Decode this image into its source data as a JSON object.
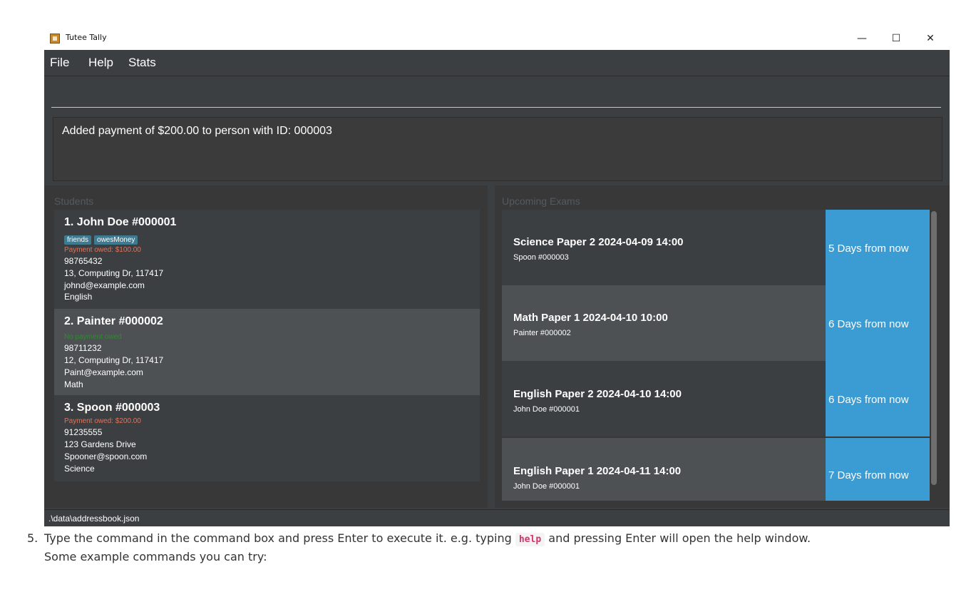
{
  "window": {
    "title": "Tutee Tally",
    "controls": {
      "minimize": "—",
      "maximize": "☐",
      "close": "✕"
    }
  },
  "menu": {
    "file": "File",
    "help": "Help",
    "stats": "Stats"
  },
  "command_box": {
    "value": ""
  },
  "result": {
    "text": "Added payment of $200.00 to person with ID: 000003"
  },
  "students": {
    "title": "Students",
    "items": [
      {
        "header": "1.  John Doe  #000001",
        "tags": [
          "friends",
          "owesMoney"
        ],
        "payment": "Payment owed: $100.00",
        "payment_status": "owed",
        "phone": "98765432",
        "address": "13, Computing Dr, 117417",
        "email": "johnd@example.com",
        "subject": "English"
      },
      {
        "header": "2.  Painter  #000002",
        "tags": [],
        "payment": "No payment owed",
        "payment_status": "paid",
        "phone": "98711232",
        "address": "12, Computing Dr, 117417",
        "email": "Paint@example.com",
        "subject": "Math"
      },
      {
        "header": "3.  Spoon  #000003",
        "tags": [],
        "payment": "Payment owed: $200.00",
        "payment_status": "owed",
        "phone": "91235555",
        "address": "123 Gardens Drive",
        "email": "Spooner@spoon.com",
        "subject": "Science"
      }
    ]
  },
  "exams": {
    "title": "Upcoming Exams",
    "items": [
      {
        "name": "Science Paper 2 2024-04-09 14:00",
        "student": "Spoon  #000003",
        "countdown": "5 Days from now"
      },
      {
        "name": "Math Paper 1 2024-04-10 10:00",
        "student": "Painter  #000002",
        "countdown": "6 Days from now"
      },
      {
        "name": "English Paper 2 2024-04-10 14:00",
        "student": "John Doe  #000001",
        "countdown": "6 Days from now"
      },
      {
        "name": "English Paper 1 2024-04-11 14:00",
        "student": "John Doe  #000001",
        "countdown": "7 Days from now"
      }
    ]
  },
  "status_bar": {
    "path": ".\\data\\addressbook.json"
  },
  "doc": {
    "step_number": "5.",
    "before_code": "Type the command in the command box and press Enter to execute it. e.g. typing",
    "code": "help",
    "after_code": "and pressing Enter will open the help window.",
    "line2": "Some example commands you can try:"
  },
  "colors": {
    "window_bg": "#3c3f41",
    "panel_bg": "#383838",
    "card_selected": "#4d5154",
    "exam_days_bg": "#3b9bd3",
    "owed_text": "#e2725b",
    "paid_text": "#2e8b2e",
    "tag_bg": "#3e7b91"
  }
}
